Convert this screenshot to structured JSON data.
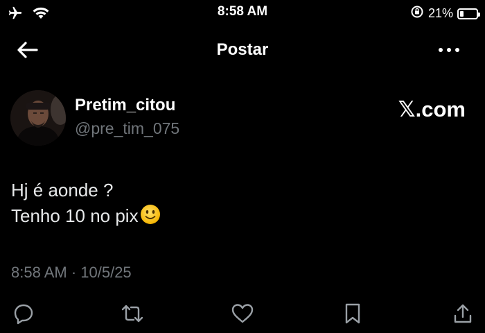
{
  "status_bar": {
    "time": "8:58 AM",
    "battery_percent": "21%",
    "battery_level": 0.21,
    "icons": [
      "airplane-icon",
      "wifi-icon",
      "orientation-lock-icon",
      "battery-icon"
    ]
  },
  "header": {
    "title": "Postar",
    "icons": [
      "back-arrow-icon",
      "more-icon"
    ]
  },
  "post": {
    "author": {
      "display_name": "Pretim_citou",
      "handle": "@pre_tim_075"
    },
    "watermark": "𝕏.com",
    "text_lines": [
      "Hj é aonde ?",
      "Tenho 10 no pix"
    ],
    "emoji": "slightly-smiling-face",
    "timestamp": "8:58 AM · 10/5/25"
  },
  "actions": {
    "icons": [
      "reply-icon",
      "repost-icon",
      "like-icon",
      "bookmark-icon",
      "share-icon"
    ]
  },
  "colors": {
    "background": "#000000",
    "primary_text": "#e7e9ea",
    "secondary_text": "#71767b",
    "icon": "#9aa0a6"
  }
}
